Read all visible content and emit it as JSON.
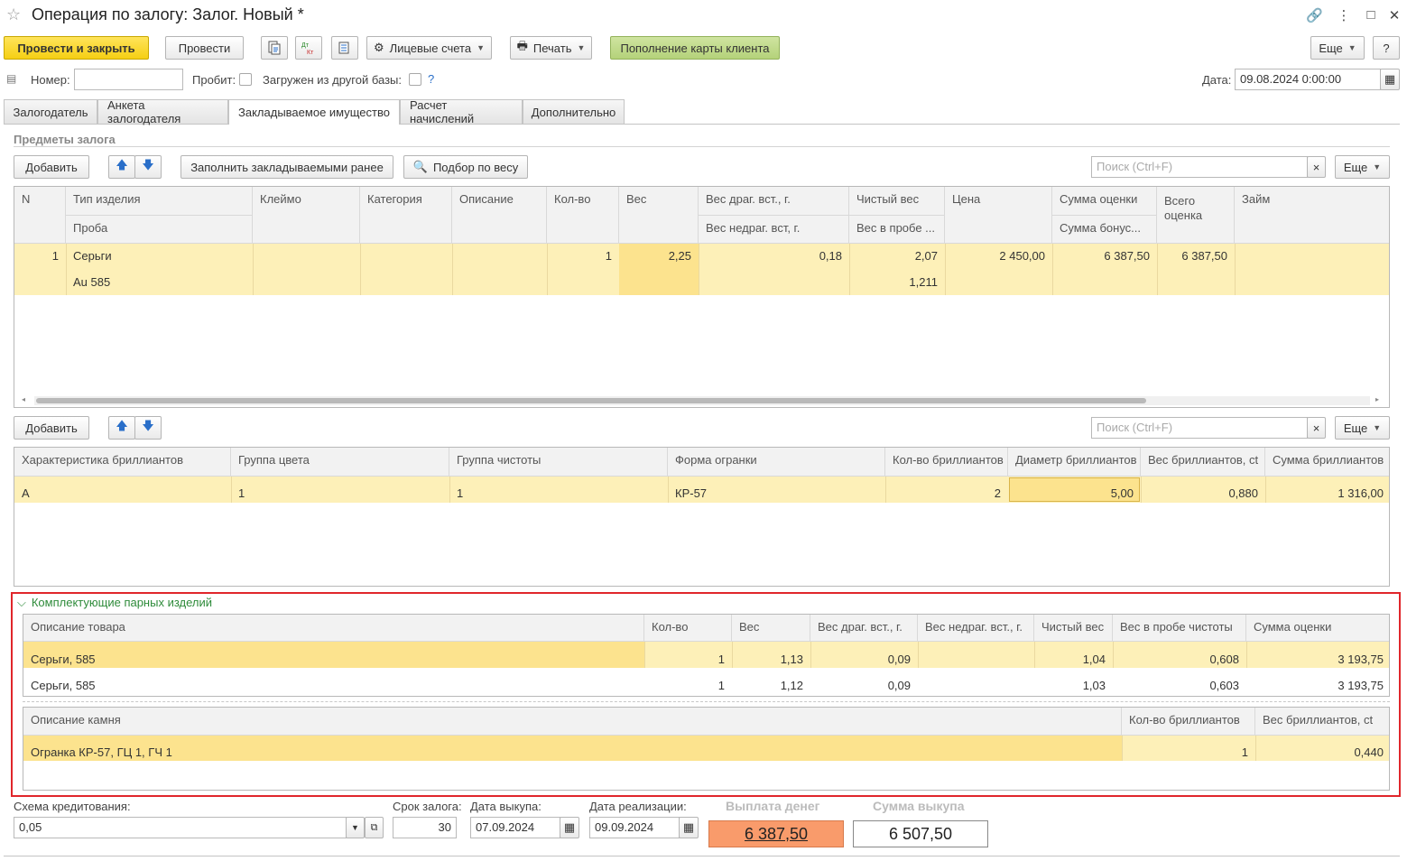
{
  "window": {
    "title": "Операция по залогу: Залог. Новый *"
  },
  "toolbar": {
    "post_close": "Провести и закрыть",
    "post": "Провести",
    "accounts": "Лицевые счета",
    "print": "Печать",
    "topup": "Пополнение карты клиента",
    "more": "Еще",
    "help": "?"
  },
  "header": {
    "number_label": "Номер:",
    "number_value": "",
    "probit_label": "Пробит:",
    "loaded_label": "Загружен из другой базы:",
    "loaded_help": "?",
    "date_label": "Дата:",
    "date_value": "09.08.2024  0:00:00"
  },
  "tabs": [
    {
      "label": "Залогодатель"
    },
    {
      "label": "Анкета залогодателя"
    },
    {
      "label": "Закладываемое имущество"
    },
    {
      "label": "Расчет начислений"
    },
    {
      "label": "Дополнительно"
    }
  ],
  "items_section": {
    "title": "Предметы залога",
    "add": "Добавить",
    "fill": "Заполнить закладываемыми ранее",
    "pick": "Подбор по весу",
    "search_placeholder": "Поиск (Ctrl+F)",
    "more": "Еще",
    "columns": {
      "n": "N",
      "type": "Тип изделия",
      "probe": "Проба",
      "stamp": "Клеймо",
      "category": "Категория",
      "description": "Описание",
      "qty": "Кол-во",
      "weight": "Вес",
      "precious_ins": "Вес драг. вст., г.",
      "nonprecious_ins": "Вес недраг. вст, г.",
      "net_weight": "Чистый вес",
      "weight_probe": "Вес в пробе ...",
      "price": "Цена",
      "appraisal": "Сумма оценки",
      "bonus": "Сумма бонус...",
      "total_appraisal": "Всего оценка",
      "loan": "Займ"
    },
    "rows": [
      {
        "n": "1",
        "type": "Серьги",
        "probe": "Au 585",
        "qty": "1",
        "weight": "2,25",
        "precious_ins": "0,18",
        "net_weight": "2,07",
        "weight_probe": "1,211",
        "price": "2 450,00",
        "appraisal": "6 387,50",
        "total_appraisal": "6 387,50"
      }
    ]
  },
  "diamonds_section": {
    "add": "Добавить",
    "search_placeholder": "Поиск (Ctrl+F)",
    "more": "Еще",
    "columns": {
      "char": "Характеристика бриллиантов",
      "color": "Группа цвета",
      "clarity": "Группа чистоты",
      "cut": "Форма огранки",
      "count": "Кол-во бриллиантов",
      "diameter": "Диаметр бриллиантов",
      "weight": "Вес бриллиантов, ct",
      "sum": "Сумма бриллиантов"
    },
    "rows": [
      {
        "char": "А",
        "color": "1",
        "clarity": "1",
        "cut": "КР-57",
        "count": "2",
        "diameter": "5,00",
        "weight": "0,880",
        "sum": "1 316,00"
      }
    ]
  },
  "paired_section": {
    "title": "Комплектующие парных изделий",
    "columns": {
      "desc": "Описание товара",
      "qty": "Кол-во",
      "weight": "Вес",
      "precious": "Вес драг. вст., г.",
      "nonprecious": "Вес недраг. вст., г.",
      "net": "Чистый вес",
      "probe_weight": "Вес в пробе чистоты",
      "appraisal": "Сумма оценки"
    },
    "rows": [
      {
        "desc": "Серьги, 585",
        "qty": "1",
        "weight": "1,13",
        "precious": "0,09",
        "net": "1,04",
        "probe_weight": "0,608",
        "appraisal": "3 193,75"
      },
      {
        "desc": "Серьги, 585",
        "qty": "1",
        "weight": "1,12",
        "precious": "0,09",
        "net": "1,03",
        "probe_weight": "0,603",
        "appraisal": "3 193,75"
      }
    ],
    "stone_columns": {
      "desc": "Описание камня",
      "count": "Кол-во бриллиантов",
      "weight": "Вес бриллиантов, ct"
    },
    "stone_rows": [
      {
        "desc": "Огранка КР-57, ГЦ 1, ГЧ 1",
        "count": "1",
        "weight": "0,440"
      }
    ]
  },
  "footer": {
    "scheme_label": "Схема кредитования:",
    "scheme_value": "0,05",
    "term_label": "Срок залога:",
    "term_value": "30",
    "redeem_date_label": "Дата выкупа:",
    "redeem_date_value": "07.09.2024",
    "sale_date_label": "Дата реализации:",
    "sale_date_value": "09.09.2024",
    "payout_label": "Выплата денег",
    "payout_value": "6 387,50",
    "redeem_sum_label": "Сумма выкупа",
    "redeem_sum_value": "6 507,50"
  },
  "colors": {
    "primary_button": "#f5cf14",
    "green_button": "#b4d27a",
    "selected_row": "#fdf0b8",
    "active_cell": "#fce38e",
    "payout_bg": "#f99b6b",
    "highlight_border": "#e0262b",
    "section_green": "#2e8b3a"
  }
}
